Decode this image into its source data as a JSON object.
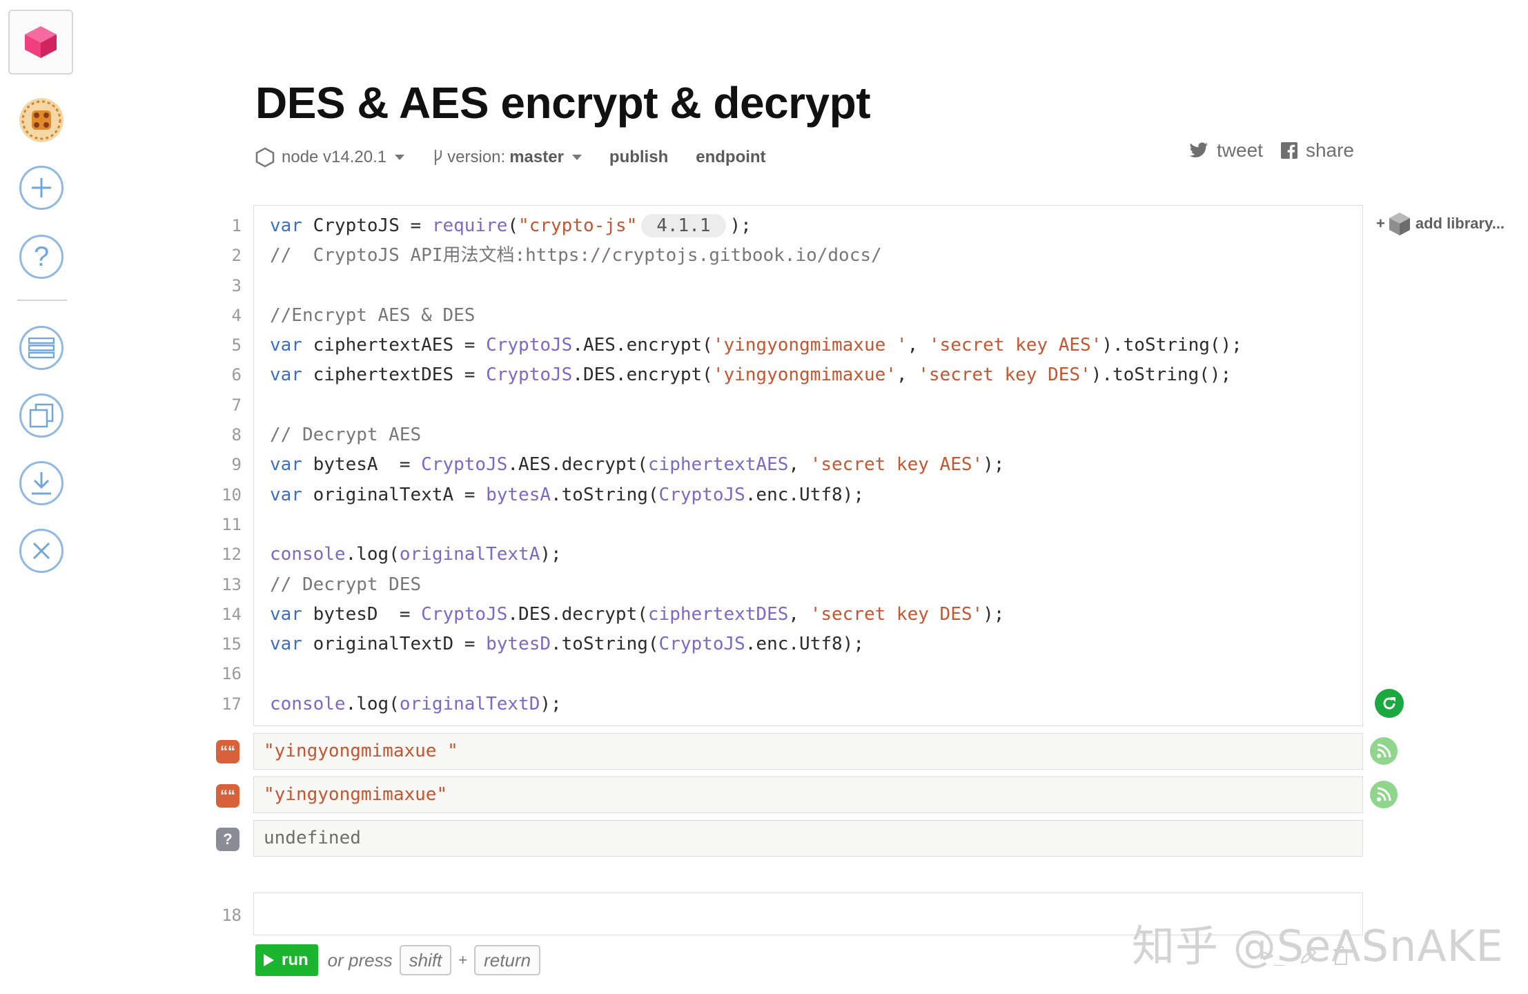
{
  "sidebar": {
    "items": [
      "new-notebook",
      "help",
      "list",
      "clone",
      "download",
      "close"
    ]
  },
  "page": {
    "title": "DES & AES encrypt & decrypt",
    "node_version": "node v14.20.1",
    "version_label": "version:",
    "version_value": "master",
    "publish": "publish",
    "endpoint": "endpoint",
    "tweet": "tweet",
    "share": "share",
    "add_library": "add library..."
  },
  "code": {
    "line_numbers": [
      "1",
      "2",
      "3",
      "4",
      "5",
      "6",
      "7",
      "8",
      "9",
      "10",
      "11",
      "12",
      "13",
      "14",
      "15",
      "16",
      "17"
    ],
    "library_version": "4.1.1",
    "l1a": "var",
    "l1b": " CryptoJS = ",
    "l1c": "require",
    "l1d": "(",
    "l1e": "\"crypto-js\"",
    "l1f": ");",
    "l2": "//  CryptoJS API用法文档:https://cryptojs.gitbook.io/docs/",
    "l4": "//Encrypt AES & DES",
    "l5": {
      "v": "var",
      " a": "",
      "name": " ciphertextAES = ",
      "obj": "CryptoJS",
      "m": ".AES.encrypt(",
      "s1": "'yingyongmimaxue '",
      "c": ", ",
      "s2": "'secret key AES'",
      "end": ").toString();"
    },
    "l6": {
      "v": "var",
      "name": " ciphertextDES = ",
      "obj": "CryptoJS",
      "m": ".DES.encrypt(",
      "s1": "'yingyongmimaxue'",
      "c": ", ",
      "s2": "'secret key DES'",
      "end": ").toString();"
    },
    "l8": "// Decrypt AES",
    "l9": {
      "v": "var",
      "name": " bytesA  = ",
      "obj": "CryptoJS",
      "m": ".AES.decrypt(",
      "arg": "ciphertextAES",
      "c": ", ",
      "s": "'secret key AES'",
      "end": ");"
    },
    "l10": {
      "v": "var",
      "name": " originalTextA = ",
      "obj": "bytesA",
      "m": ".toString(",
      "obj2": "CryptoJS",
      "end": ".enc.Utf8);"
    },
    "l12": {
      "obj": "console",
      "m": ".log(",
      "arg": "originalTextA",
      "end": ");"
    },
    "l13": "// Decrypt DES",
    "l14": {
      "v": "var",
      "name": " bytesD  = ",
      "obj": "CryptoJS",
      "m": ".DES.decrypt(",
      "arg": "ciphertextDES",
      "c": ", ",
      "s": "'secret key DES'",
      "end": ");"
    },
    "l15": {
      "v": "var",
      "name": " originalTextD = ",
      "obj": "bytesD",
      "m": ".toString(",
      "obj2": "CryptoJS",
      "end": ".enc.Utf8);"
    },
    "l17": {
      "obj": "console",
      "m": ".log(",
      "arg": "originalTextD",
      "end": ");"
    }
  },
  "outputs": [
    {
      "type": "string",
      "badge": "““",
      "text": "\"yingyongmimaxue \""
    },
    {
      "type": "string",
      "badge": "““",
      "text": "\"yingyongmimaxue\""
    },
    {
      "type": "undefined",
      "badge": "?",
      "text": "undefined"
    }
  ],
  "new_cell": {
    "line_number": "18",
    "run": "run",
    "or_press": "or press",
    "key1": "shift",
    "plus": "+",
    "key2": "return"
  },
  "watermark": "知乎 @SeASnAKE",
  "colors": {
    "keyword": "#3b6fc7",
    "function": "#7a69c9",
    "string": "#c7552f",
    "run_green": "#1bb52f",
    "badge_string": "#d9613a",
    "badge_undefined": "#8c8c96"
  }
}
